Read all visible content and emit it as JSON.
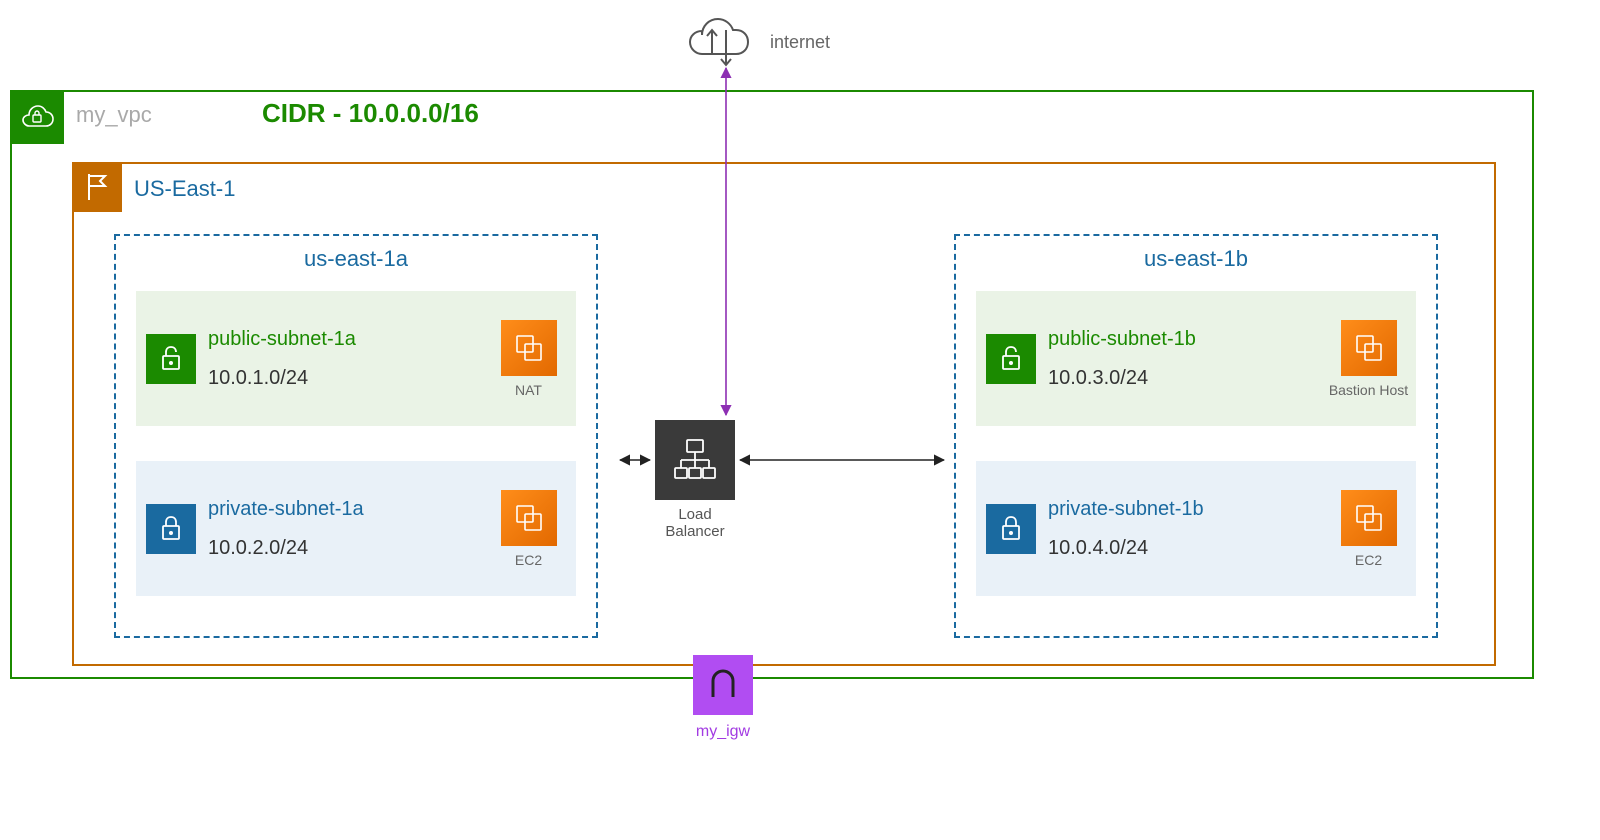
{
  "internet": {
    "label": "internet"
  },
  "vpc": {
    "name": "my_vpc",
    "cidr_label": "CIDR - 10.0.0.0/16"
  },
  "region": {
    "name": "US-East-1"
  },
  "azs": {
    "a": {
      "name": "us-east-1a",
      "public": {
        "name": "public-subnet-1a",
        "cidr": "10.0.1.0/24",
        "host_label": "NAT"
      },
      "private": {
        "name": "private-subnet-1a",
        "cidr": "10.0.2.0/24",
        "host_label": "EC2"
      }
    },
    "b": {
      "name": "us-east-1b",
      "public": {
        "name": "public-subnet-1b",
        "cidr": "10.0.3.0/24",
        "host_label": "Bastion Host"
      },
      "private": {
        "name": "private-subnet-1b",
        "cidr": "10.0.4.0/24",
        "host_label": "EC2"
      }
    }
  },
  "lb": {
    "label": "Load\nBalancer"
  },
  "igw": {
    "name": "my_igw"
  },
  "colors": {
    "vpc_border": "#1b8a00",
    "region_border": "#c26a00",
    "az_border": "#1a6aa0",
    "ec2": "#ff8d1a",
    "igw": "#b14df2",
    "lb": "#3a3a3a",
    "arrow_purple": "#8d2fb3",
    "arrow_black": "#222"
  }
}
